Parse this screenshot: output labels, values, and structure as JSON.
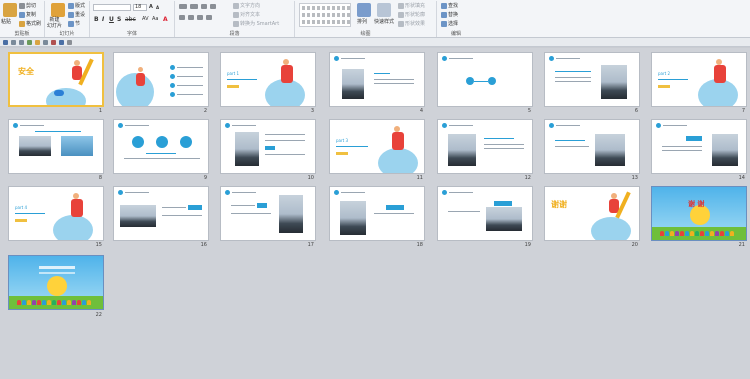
{
  "ribbon": {
    "clipboard": {
      "paste": "粘贴",
      "cut": "剪切",
      "copy": "复制",
      "format_painter": "格式刷",
      "label": "剪贴板"
    },
    "slides": {
      "new_slide": "新建\n幻灯片",
      "layout": "版式",
      "reset": "重设",
      "section": "节",
      "label": "幻灯片"
    },
    "font": {
      "size": "18",
      "label": "字体"
    },
    "paragraph": {
      "text_direction": "文字方向",
      "align_text": "对齐文本",
      "smartart": "转换为 SmartArt",
      "label": "段落"
    },
    "drawing": {
      "arrange": "排列",
      "quick_styles": "快速样式",
      "shape_fill": "形状填充",
      "shape_outline": "形状轮廓",
      "shape_effects": "形状效果",
      "label": "绘图"
    },
    "editing": {
      "find": "查找",
      "replace": "替换",
      "select": "选择",
      "label": "编辑"
    }
  },
  "slides": [
    {
      "n": "1"
    },
    {
      "n": "2"
    },
    {
      "n": "3"
    },
    {
      "n": "4"
    },
    {
      "n": "5"
    },
    {
      "n": "6"
    },
    {
      "n": "7"
    },
    {
      "n": "8"
    },
    {
      "n": "9"
    },
    {
      "n": "10"
    },
    {
      "n": "11"
    },
    {
      "n": "12"
    },
    {
      "n": "13"
    },
    {
      "n": "14"
    },
    {
      "n": "15"
    },
    {
      "n": "16"
    },
    {
      "n": "17"
    },
    {
      "n": "18"
    },
    {
      "n": "19"
    },
    {
      "n": "20"
    },
    {
      "n": "21"
    },
    {
      "n": "22"
    }
  ],
  "thanks": "谢  谢",
  "colors": {
    "accent": "#2a9fd6",
    "selected": "#f0c040",
    "ribbon": "#f3f5f8"
  }
}
